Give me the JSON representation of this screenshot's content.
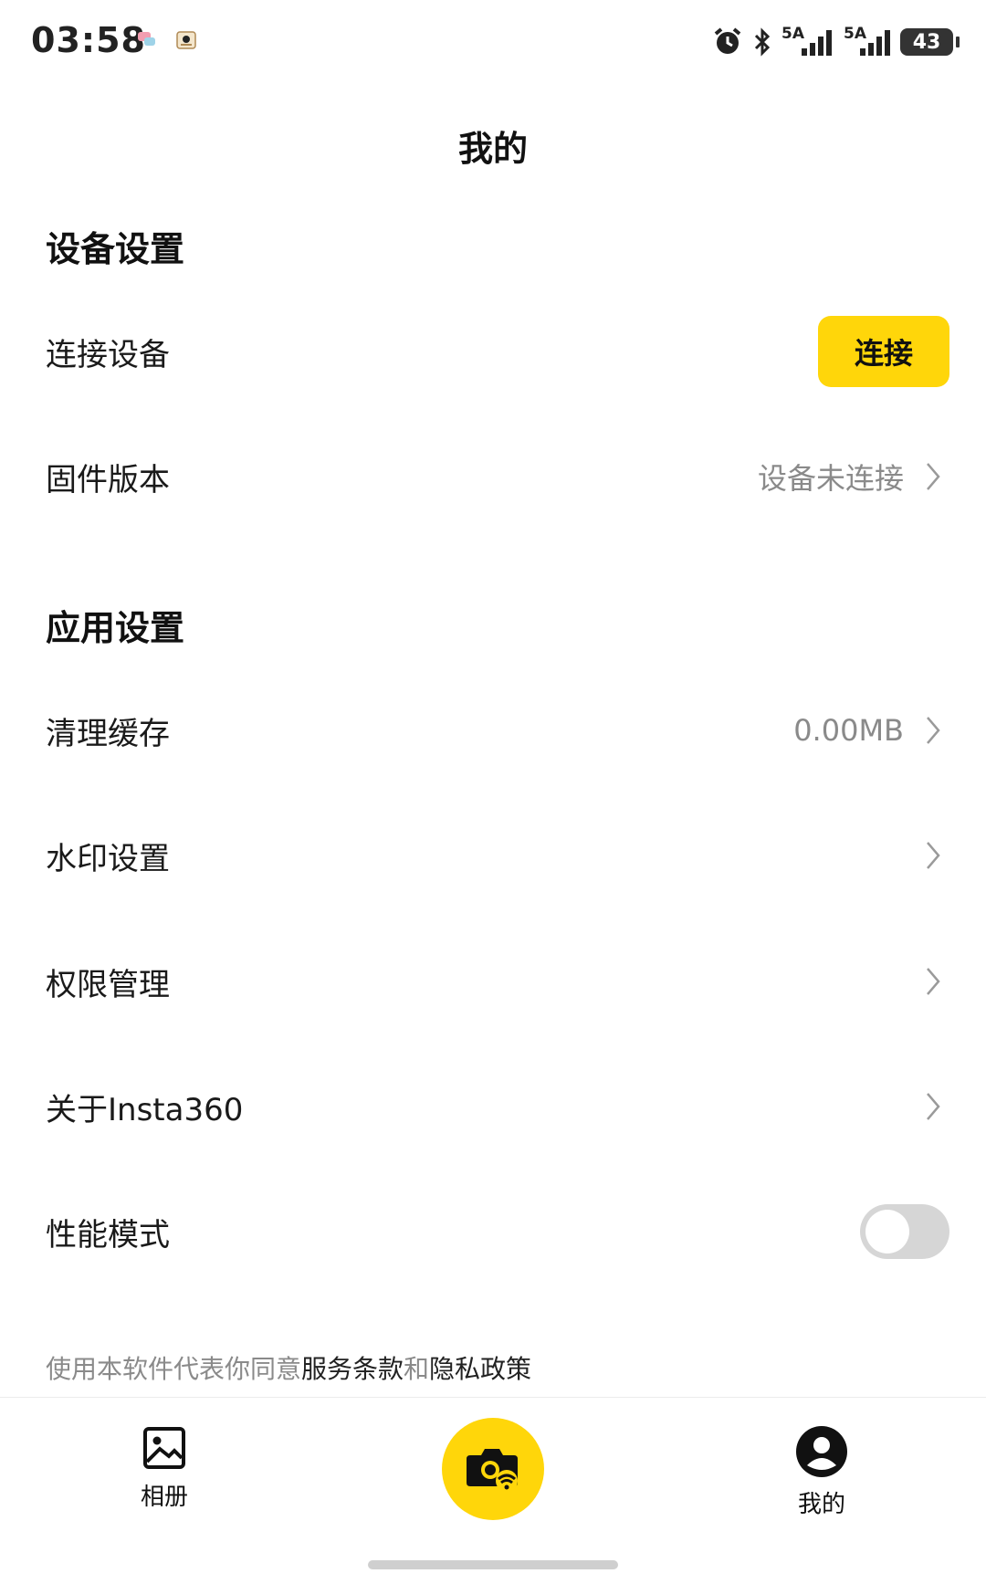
{
  "status_bar": {
    "time": "03:58",
    "battery": "43",
    "network1": "5A",
    "network2": "5A",
    "icons": [
      "alarm-icon",
      "bluetooth-icon",
      "signal-icon",
      "signal-icon",
      "battery-icon"
    ]
  },
  "header": {
    "title": "我的"
  },
  "device_settings": {
    "title": "设备设置",
    "connect_label": "连接设备",
    "connect_button": "连接",
    "firmware_label": "固件版本",
    "firmware_value": "设备未连接"
  },
  "app_settings": {
    "title": "应用设置",
    "cache_label": "清理缓存",
    "cache_value": "0.00MB",
    "watermark_label": "水印设置",
    "permissions_label": "权限管理",
    "about_label": "关于Insta360",
    "performance_label": "性能模式",
    "performance_enabled": false
  },
  "terms": {
    "prefix": "使用本软件代表你同意",
    "service_link": "服务条款",
    "and": "和",
    "privacy_link": "隐私政策"
  },
  "bottom_nav": {
    "album_label": "相册",
    "mine_label": "我的"
  },
  "colors": {
    "accent": "#ffd60a",
    "muted": "#8a8a8a"
  }
}
